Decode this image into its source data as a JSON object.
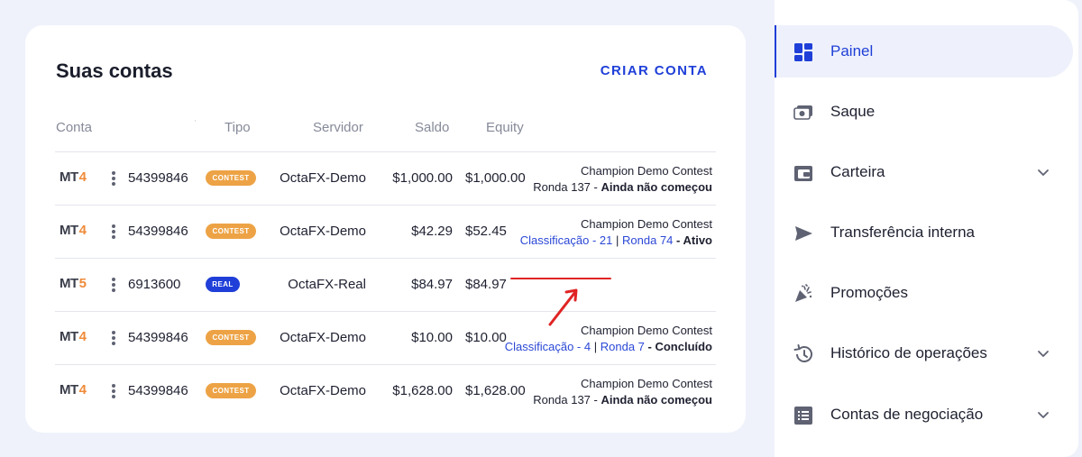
{
  "accounts_card": {
    "title": "Suas contas",
    "create_label": "CRIAR CONTA",
    "columns": {
      "conta": "Conta",
      "tipo": "Tipo",
      "servidor": "Servidor",
      "saldo": "Saldo",
      "equity": "Equity"
    },
    "header_mark": "'"
  },
  "rows": [
    {
      "platform": "MT",
      "version": "4",
      "account": "54399846",
      "badge": "CONTEST",
      "server": "OctaFX-Demo",
      "balance": "$1,000.00",
      "equity": "$1,000.00",
      "contest": "Champion Demo Contest",
      "round": "Ronda 137 - ",
      "status": "Ainda não começou"
    },
    {
      "platform": "MT",
      "version": "4",
      "account": "54399846",
      "badge": "CONTEST",
      "server": "OctaFX-Demo",
      "balance": "$42.29",
      "equity": "$52.45",
      "contest": "Champion Demo Contest",
      "classification": "Classificação - 21",
      "separator": "|",
      "round": "Ronda 74",
      "status_prefix": " - ",
      "status": "Ativo"
    },
    {
      "platform": "MT",
      "version": "5",
      "account": "6913600",
      "badge": "REAL",
      "server": "OctaFX-Real",
      "balance": "$84.97",
      "equity": "$84.97"
    },
    {
      "platform": "MT",
      "version": "4",
      "account": "54399846",
      "badge": "CONTEST",
      "server": "OctaFX-Demo",
      "balance": "$10.00",
      "equity": "$10.00",
      "contest": "Champion Demo Contest",
      "classification": "Classificação - 4",
      "separator": "|",
      "round": "Ronda 7",
      "status_prefix": " - ",
      "status": "Concluído"
    },
    {
      "platform": "MT",
      "version": "4",
      "account": "54399846",
      "badge": "CONTEST",
      "server": "OctaFX-Demo",
      "balance": "$1,628.00",
      "equity": "$1,628.00",
      "contest": "Champion Demo Contest",
      "round": "Ronda 137 - ",
      "status": "Ainda não começou"
    }
  ],
  "sidebar": {
    "items": [
      {
        "label": "Painel",
        "icon": "dashboard-icon",
        "active": true,
        "expandable": false
      },
      {
        "label": "Saque",
        "icon": "withdraw-icon",
        "active": false,
        "expandable": false
      },
      {
        "label": "Carteira",
        "icon": "wallet-icon",
        "active": false,
        "expandable": true
      },
      {
        "label": "Transferência interna",
        "icon": "send-icon",
        "active": false,
        "expandable": false
      },
      {
        "label": "Promoções",
        "icon": "party-popper-icon",
        "active": false,
        "expandable": false
      },
      {
        "label": "Histórico de operações",
        "icon": "history-icon",
        "active": false,
        "expandable": true
      },
      {
        "label": "Contas de negociação",
        "icon": "list-icon",
        "active": false,
        "expandable": true
      }
    ]
  },
  "colors": {
    "accent": "#1f3fd8",
    "contest_badge": "#eda345",
    "annotation": "#e02424",
    "mt_version": "#ef8b3a"
  }
}
